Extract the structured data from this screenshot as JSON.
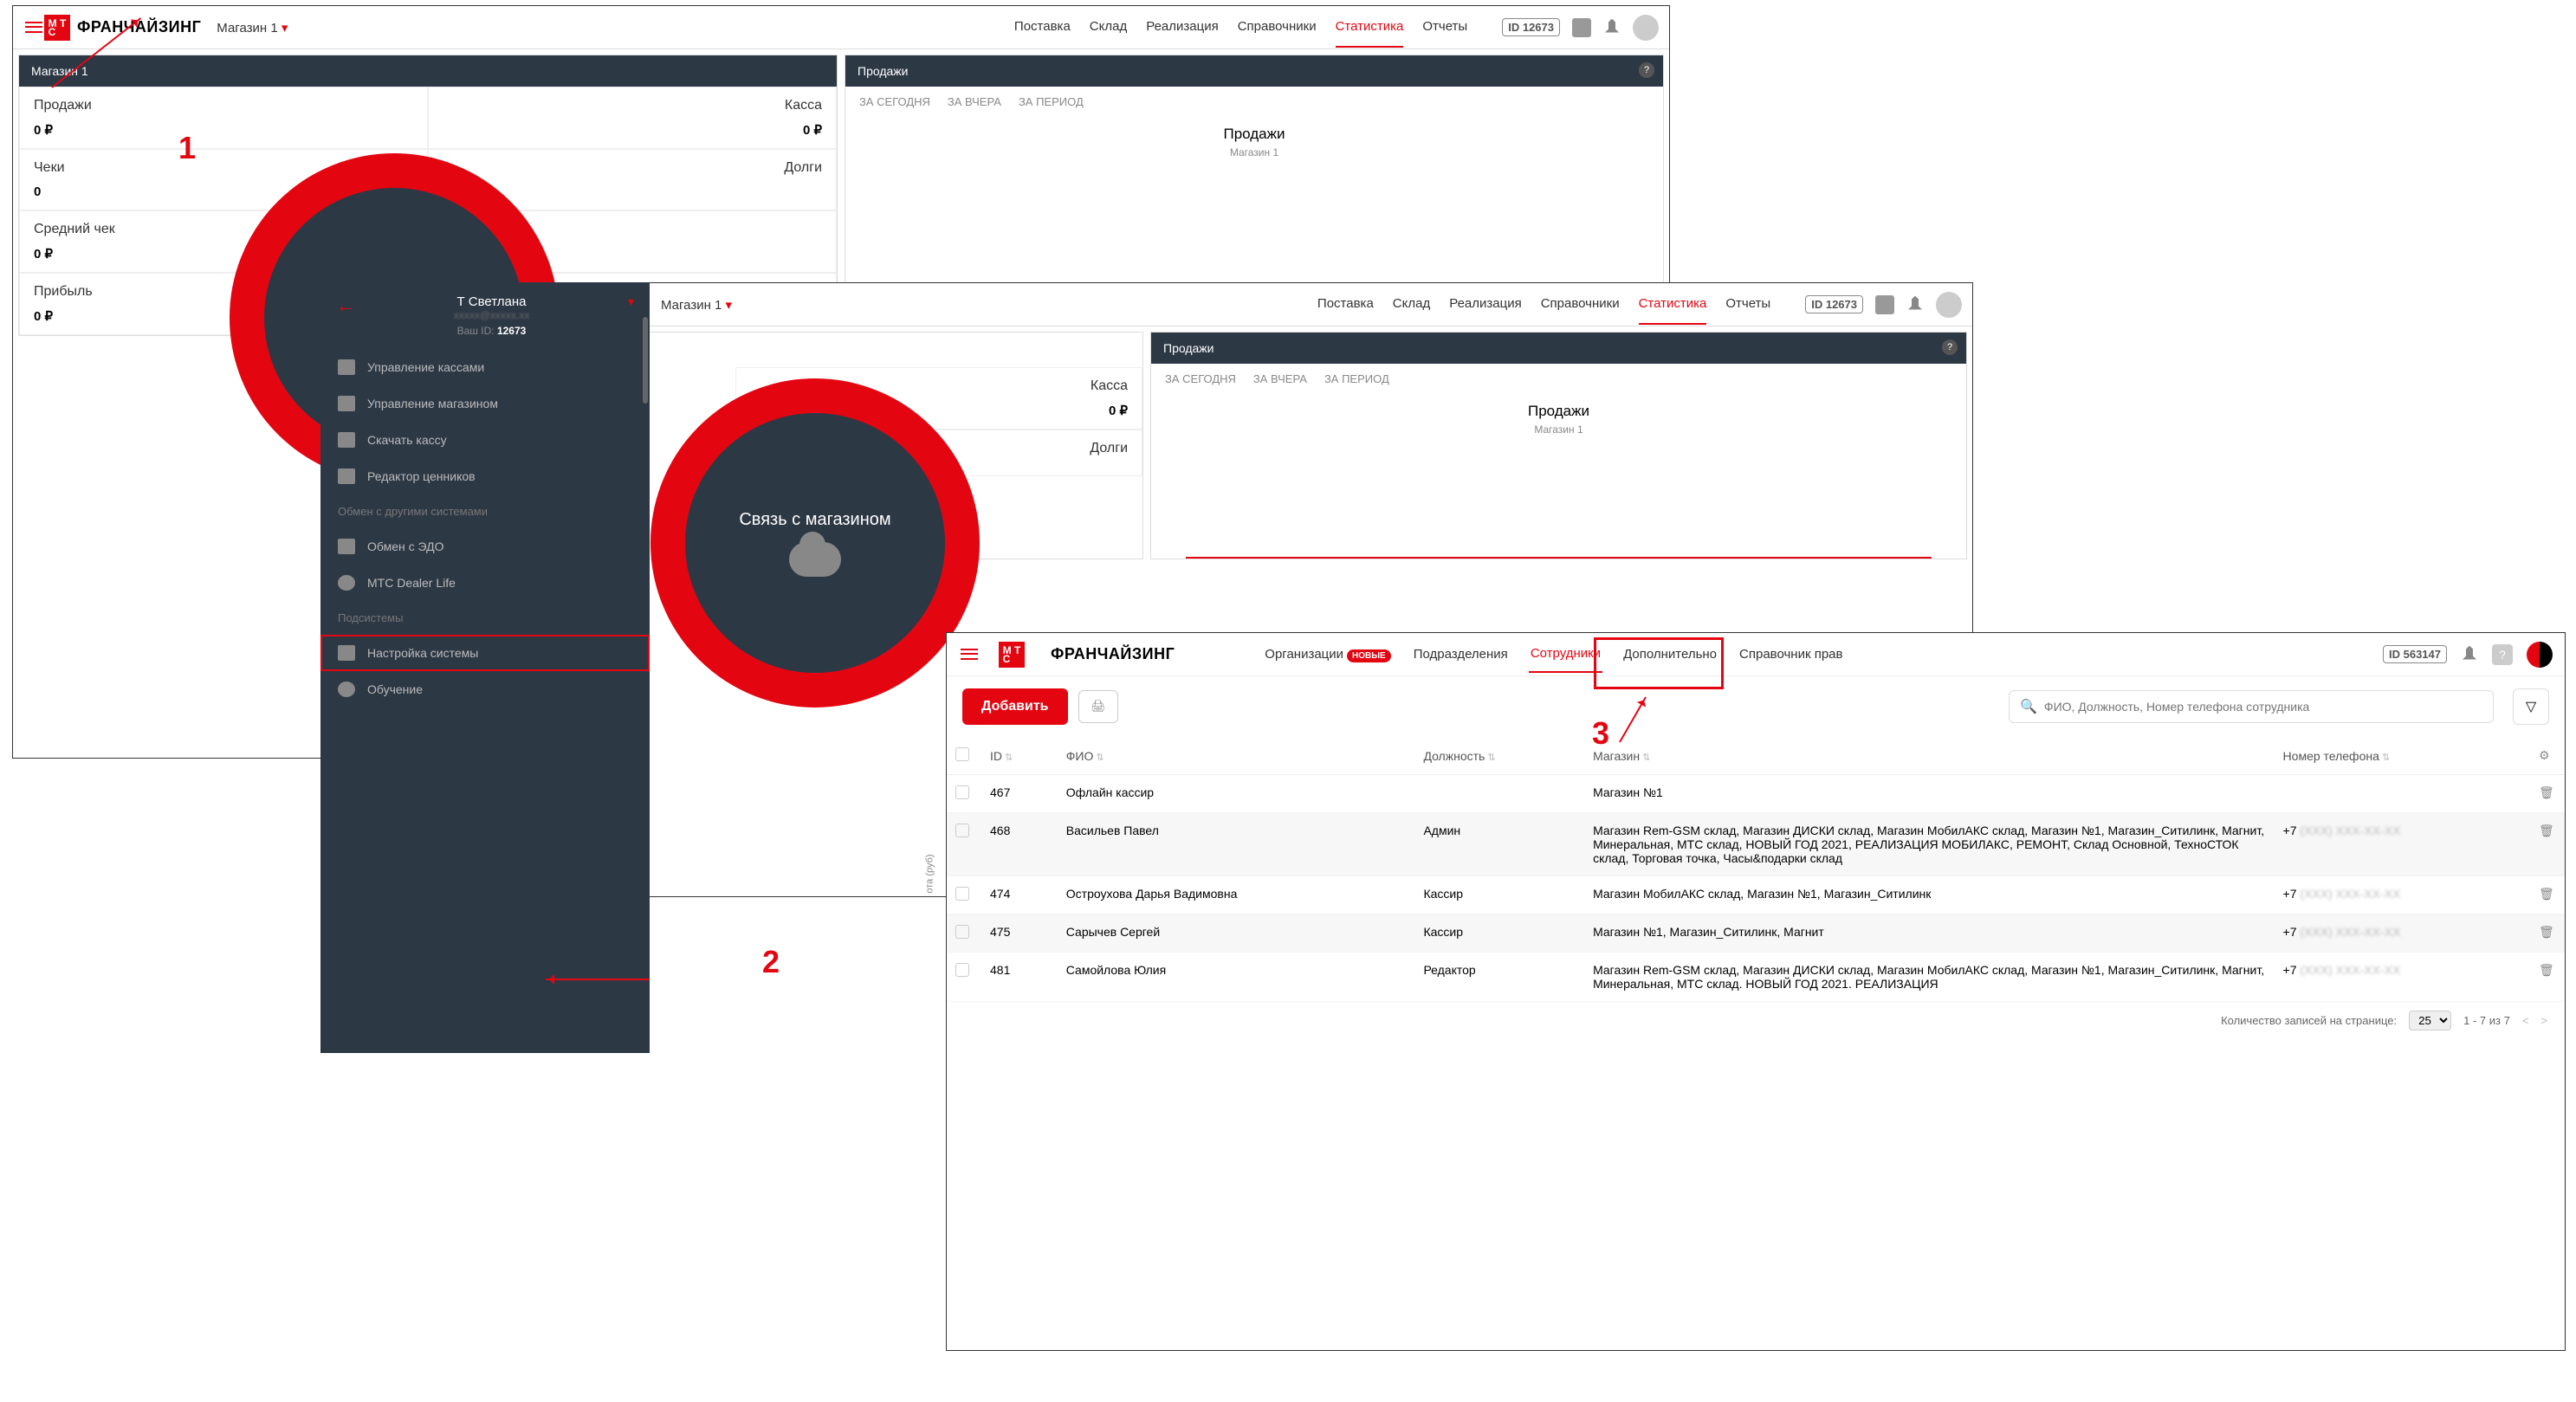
{
  "brand": "ФРАНЧАЙЗИНГ",
  "store_selector": "Магазин 1",
  "main_nav": [
    "Поставка",
    "Склад",
    "Реализация",
    "Справочники",
    "Статистика",
    "Отчеты"
  ],
  "active_nav": "Статистика",
  "user_id_small": "12673",
  "panel1": {
    "title": "Магазин 1"
  },
  "tiles": [
    {
      "label": "Продажи",
      "value": "0 ₽"
    },
    {
      "label": "Касса",
      "value": "0 ₽"
    },
    {
      "label": "Чеки",
      "value": "0"
    },
    {
      "label": "Долги",
      "value": ""
    },
    {
      "label": "Средний чек",
      "value": "0 ₽"
    },
    {
      "label": "",
      "value": ""
    },
    {
      "label": "Прибыль",
      "value": "0 ₽"
    },
    {
      "label": "",
      "value": ""
    }
  ],
  "sales_panel": {
    "title": "Продажи",
    "tabs": [
      "ЗА СЕГОДНЯ",
      "ЗА ВЧЕРА",
      "ЗА ПЕРИОД"
    ],
    "heading": "Продажи",
    "sub": "Магазин 1",
    "axis": "ота (руб)"
  },
  "circle_text": "Связь с магазином",
  "circle_text_cut": "Св",
  "side_menu": {
    "user": "Т Светлана",
    "id_label": "Ваш ID:",
    "id": "12673",
    "items_a": [
      "Управление кассами",
      "Управление магазином",
      "Скачать кассу",
      "Редактор ценников"
    ],
    "label_b": "Обмен с другими системами",
    "items_b": [
      "Обмен с ЭДО",
      "MTC Dealer Life"
    ],
    "label_c": "Подсистемы",
    "items_c": [
      "Настройка системы",
      "Обучение"
    ]
  },
  "w3": {
    "nav": [
      "Организации",
      "Подразделения",
      "Сотрудники",
      "Дополнительно",
      "Справочник прав"
    ],
    "nav_badge_on": "Организации",
    "badge": "НОВЫЕ",
    "active": "Сотрудники",
    "id": "563147",
    "add": "Добавить",
    "search_placeholder": "ФИО, Должность, Номер телефона сотрудника",
    "columns": [
      "ID",
      "ФИО",
      "Должность",
      "Магазин",
      "Номер телефона"
    ],
    "rows": [
      {
        "id": "467",
        "fio": "Офлайн кассир",
        "pos": "",
        "store": "Магазин №1",
        "phone": ""
      },
      {
        "id": "468",
        "fio": "Васильев Павел",
        "pos": "Админ",
        "store": "Магазин Rem-GSM склад, Магазин ДИСКИ склад, Магазин МобилАКС склад, Магазин №1, Магазин_Ситилинк, Магнит, Минеральная, МТС склад, НОВЫЙ ГОД 2021, РЕАЛИЗАЦИЯ МОБИЛАКС, РЕМОНТ, Склад Основной, ТехноСТОК склад, Торговая точка, Часы&подарки склад",
        "phone": "+7"
      },
      {
        "id": "474",
        "fio": "Остроухова Дарья Вадимовна",
        "pos": "Кассир",
        "store": "Магазин МобилАКС склад, Магазин №1, Магазин_Ситилинк",
        "phone": "+7"
      },
      {
        "id": "475",
        "fio": "Сарычев Сергей",
        "pos": "Кассир",
        "store": "Магазин №1, Магазин_Ситилинк, Магнит",
        "phone": "+7"
      },
      {
        "id": "481",
        "fio": "Самойлова Юлия",
        "pos": "Редактор",
        "store": "Магазин Rem-GSM склад, Магазин ДИСКИ склад, Магазин МобилАКС склад, Магазин №1, Магазин_Ситилинк, Магнит, Минеральная, МТС склад. НОВЫЙ ГОД 2021. РЕАЛИЗАЦИЯ",
        "phone": "+7"
      }
    ],
    "pager_label": "Количество записей на странице:",
    "pager_size": "25",
    "pager_range": "1 - 7 из 7"
  },
  "annotations": {
    "a1": "1",
    "a2": "2",
    "a3": "3"
  }
}
